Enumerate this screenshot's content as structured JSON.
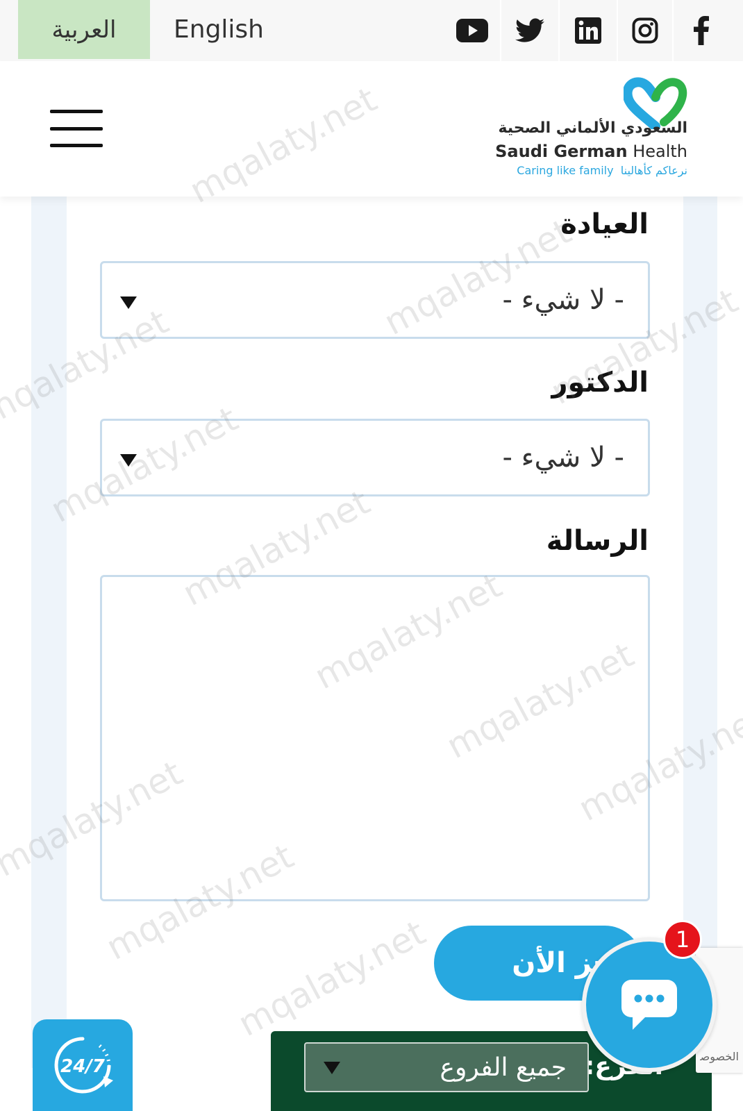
{
  "topbar": {
    "lang_arabic": "العربية",
    "lang_english": "English",
    "social": [
      "youtube-icon",
      "twitter-icon",
      "linkedin-icon",
      "instagram-icon",
      "facebook-icon"
    ]
  },
  "header": {
    "logo_arabic": "السعودي الألماني الصحية",
    "logo_english_bold": "Saudi German",
    "logo_english_light": " Health",
    "logo_tagline_en": "Caring like family",
    "logo_tagline_ar": "نرعاكم كأهالينا",
    "menu_icon": "hamburger-menu-icon"
  },
  "form": {
    "clinic_label": "العيادة",
    "clinic_value": "- لا شيء -",
    "doctor_label": "الدكتور",
    "doctor_value": "- لا شيء -",
    "message_label": "الرسالة",
    "message_value": "",
    "book_button": "احجز الأن"
  },
  "bottom": {
    "service_247": "24/7",
    "branch_label": "الفرع:",
    "branch_value": "جميع الفروع",
    "chat_badge_count": "1",
    "recaptcha_text": "الخصوصية"
  },
  "watermark": "mqalaty.net",
  "colors": {
    "accent": "#27a8e0",
    "lang_active": "#c9e6c3",
    "branch_bar": "#0b4a2c",
    "badge": "#e5141b"
  }
}
